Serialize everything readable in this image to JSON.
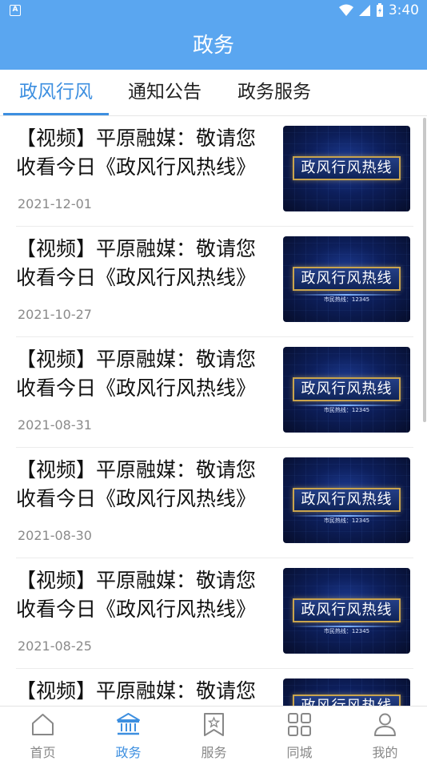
{
  "status_bar": {
    "time": "3:40",
    "notification_icon": "A"
  },
  "header": {
    "title": "政务"
  },
  "tabs": [
    {
      "label": "政风行风",
      "active": true
    },
    {
      "label": "通知公告",
      "active": false
    },
    {
      "label": "政务服务",
      "active": false
    }
  ],
  "articles": [
    {
      "title": "【视频】平原融媒：敬请您收看今日《政风行风热线》",
      "date": "2021-12-01",
      "thumb_text": "政风行风热线",
      "thumb_sub": ""
    },
    {
      "title": "【视频】平原融媒：敬请您收看今日《政风行风热线》",
      "date": "2021-10-27",
      "thumb_text": "政风行风热线",
      "thumb_sub": "市民热线：12345"
    },
    {
      "title": "【视频】平原融媒：敬请您收看今日《政风行风热线》",
      "date": "2021-08-31",
      "thumb_text": "政风行风热线",
      "thumb_sub": "市民热线：12345"
    },
    {
      "title": "【视频】平原融媒：敬请您收看今日《政风行风热线》",
      "date": "2021-08-30",
      "thumb_text": "政风行风热线",
      "thumb_sub": "市民热线：12345"
    },
    {
      "title": "【视频】平原融媒：敬请您收看今日《政风行风热线》",
      "date": "2021-08-25",
      "thumb_text": "政风行风热线",
      "thumb_sub": "市民热线：12345"
    },
    {
      "title": "【视频】平原融媒：敬请您",
      "date": "",
      "thumb_text": "政风行风热线",
      "thumb_sub": ""
    }
  ],
  "bottom_nav": [
    {
      "label": "首页",
      "icon": "home-icon",
      "active": false
    },
    {
      "label": "政务",
      "icon": "government-building-icon",
      "active": true
    },
    {
      "label": "服务",
      "icon": "star-bookmark-icon",
      "active": false
    },
    {
      "label": "同城",
      "icon": "grid-apps-icon",
      "active": false
    },
    {
      "label": "我的",
      "icon": "user-icon",
      "active": false
    }
  ],
  "colors": {
    "primary": "#5aa6f0",
    "accent": "#3d8fe0",
    "inactive": "#888888"
  }
}
